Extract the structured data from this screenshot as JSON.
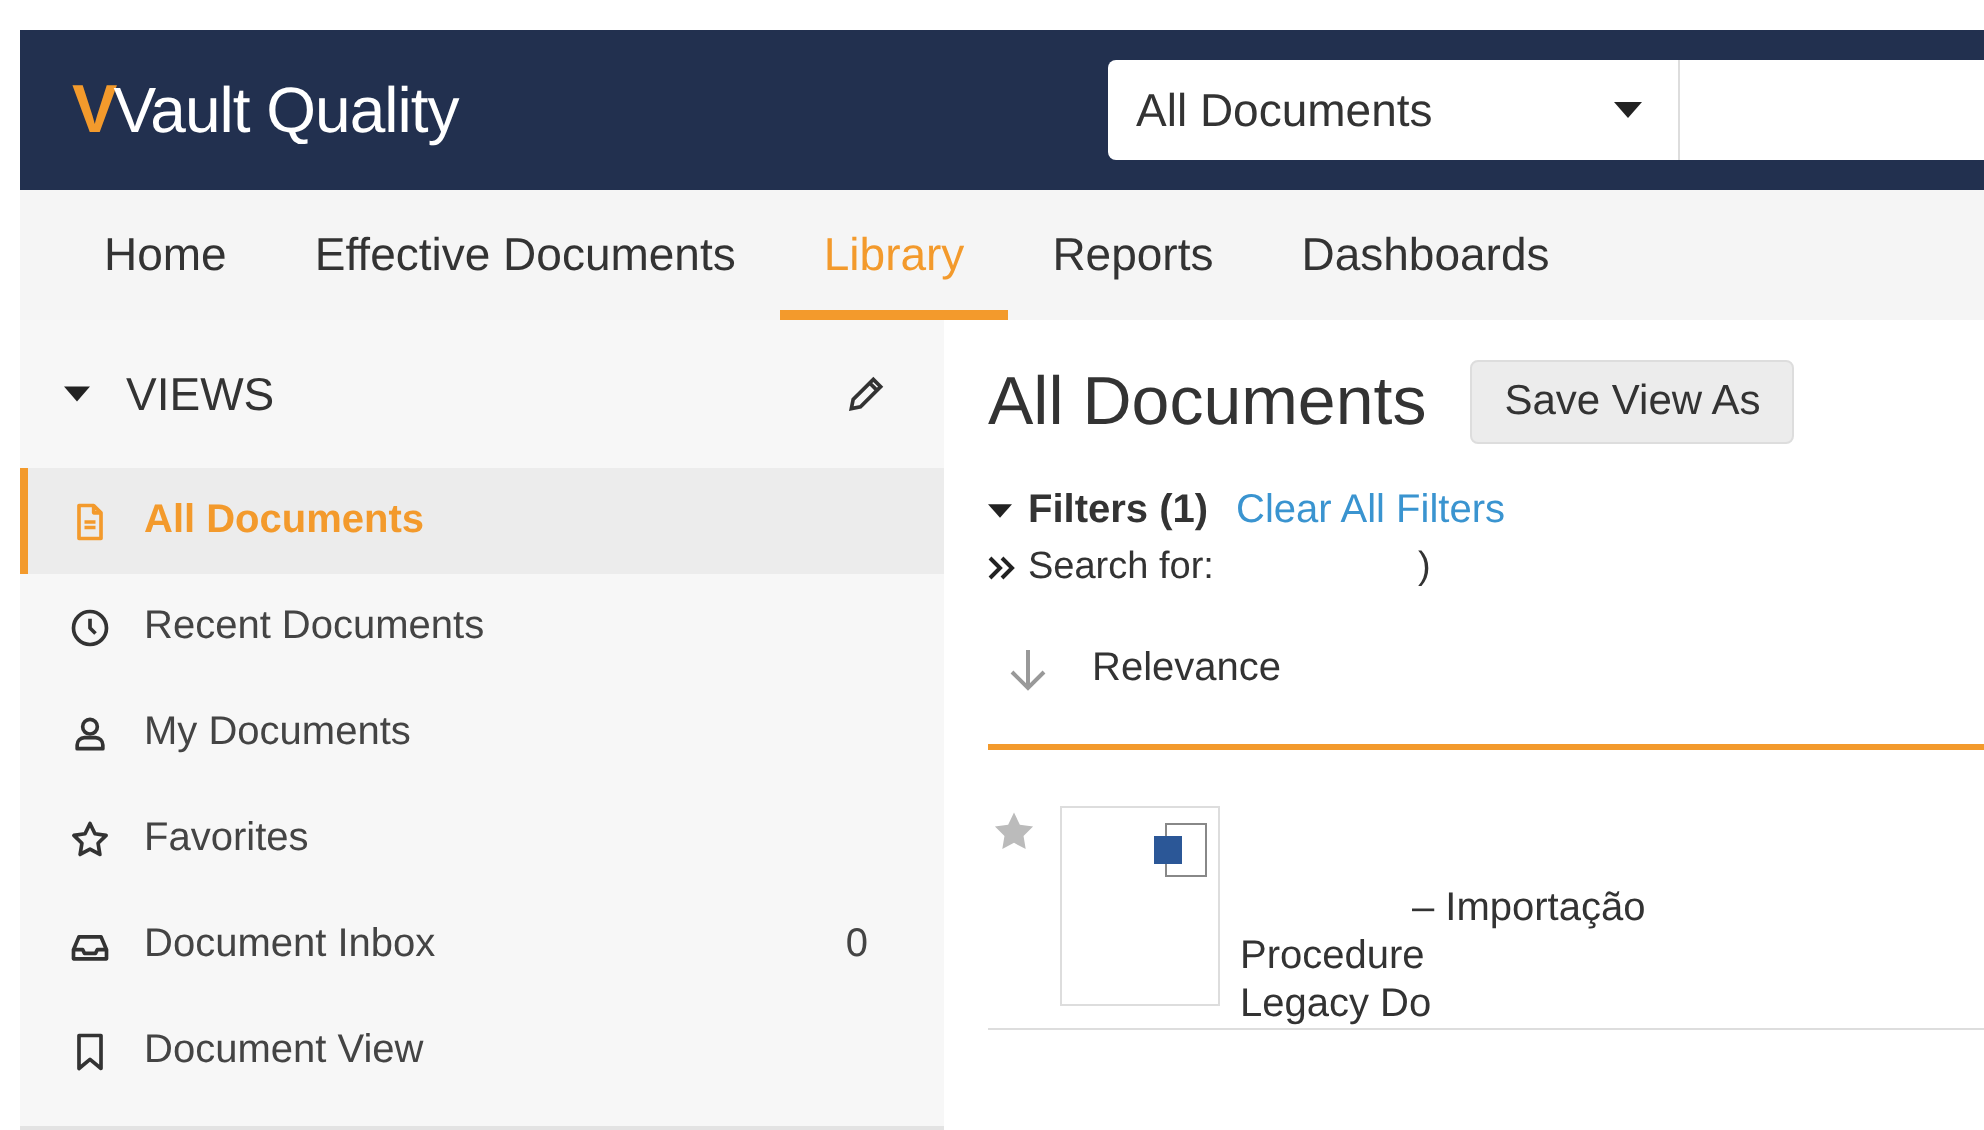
{
  "header": {
    "logo_mark": "V",
    "logo_text": "Vault Quality",
    "scope_select": {
      "value": "All Documents"
    }
  },
  "nav_tabs": [
    {
      "label": "Home",
      "selected": false
    },
    {
      "label": "Effective Documents",
      "selected": false
    },
    {
      "label": "Library",
      "selected": true
    },
    {
      "label": "Reports",
      "selected": false
    },
    {
      "label": "Dashboards",
      "selected": false
    }
  ],
  "sidebar": {
    "heading": "VIEWS",
    "items": [
      {
        "kind": "document",
        "label": "All Documents",
        "selected": true
      },
      {
        "kind": "clock",
        "label": "Recent Documents",
        "selected": false
      },
      {
        "kind": "person",
        "label": "My Documents",
        "selected": false
      },
      {
        "kind": "star",
        "label": "Favorites",
        "selected": false
      },
      {
        "kind": "inbox",
        "label": "Document Inbox",
        "count": "0",
        "selected": false
      },
      {
        "kind": "bookmark",
        "label": "Document View",
        "selected": false
      }
    ]
  },
  "main": {
    "title": "All Documents",
    "save_button": "Save View As",
    "filters": {
      "label": "Filters (1)",
      "clear_link": "Clear All Filters",
      "search_label": "Search for:",
      "search_tail": ")"
    },
    "sort": {
      "label": "Relevance"
    },
    "results": [
      {
        "favorite": false,
        "title": "– Importação",
        "lines": [
          "Procedure",
          "Legacy Do"
        ]
      }
    ]
  }
}
